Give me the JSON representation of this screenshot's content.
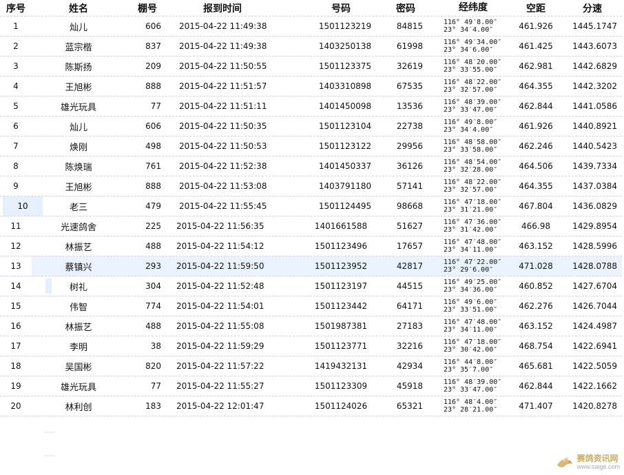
{
  "headers": {
    "idx": "序号",
    "name": "姓名",
    "loft": "棚号",
    "time": "报到时间",
    "ring": "号码",
    "pin": "密码",
    "coord": "经纬度",
    "distance": "空距",
    "speed": "分速"
  },
  "rows": [
    {
      "idx": "1",
      "name": "灿儿",
      "loft": "606",
      "time": "2015-04-22  11:49:38",
      "ring": "1501123219",
      "pin": "84815",
      "lon": "116° 49′8.00″",
      "lat": "23° 34′4.00″",
      "distance": "461.926",
      "speed": "1445.1747"
    },
    {
      "idx": "2",
      "name": "蓝宗楷",
      "loft": "837",
      "time": "2015-04-22  11:49:38",
      "ring": "1403250138",
      "pin": "61998",
      "lon": "116° 49′34.00″",
      "lat": "23° 34′6.00″",
      "distance": "461.425",
      "speed": "1443.6073"
    },
    {
      "idx": "3",
      "name": "陈斯扬",
      "loft": "209",
      "time": "2015-04-22  11:50:55",
      "ring": "1501123375",
      "pin": "32619",
      "lon": "116° 48′20.00″",
      "lat": "23° 33′55.00″",
      "distance": "462.981",
      "speed": "1442.6829"
    },
    {
      "idx": "4",
      "name": "王旭彬",
      "loft": "888",
      "time": "2015-04-22  11:51:57",
      "ring": "1403310898",
      "pin": "67535",
      "lon": "116° 48′22.00″",
      "lat": "23° 32′57.00″",
      "distance": "464.355",
      "speed": "1442.3202"
    },
    {
      "idx": "5",
      "name": "雄光玩具",
      "loft": "77",
      "time": "2015-04-22  11:51:11",
      "ring": "1401450098",
      "pin": "13536",
      "lon": "116° 48′39.00″",
      "lat": "23° 33′47.00″",
      "distance": "462.844",
      "speed": "1441.0586"
    },
    {
      "idx": "6",
      "name": "灿儿",
      "loft": "606",
      "time": "2015-04-22  11:50:35",
      "ring": "1501123104",
      "pin": "22738",
      "lon": "116° 49′8.00″",
      "lat": "23° 34′4.00″",
      "distance": "461.926",
      "speed": "1440.8921"
    },
    {
      "idx": "7",
      "name": "焕刚",
      "loft": "498",
      "time": "2015-04-22  11:50:53",
      "ring": "1501123122",
      "pin": "29956",
      "lon": "116° 48′58.00″",
      "lat": "23° 33′58.00″",
      "distance": "462.246",
      "speed": "1440.5423"
    },
    {
      "idx": "8",
      "name": "陈焕瑞",
      "loft": "761",
      "time": "2015-04-22  11:52:38",
      "ring": "1401450337",
      "pin": "36126",
      "lon": "116° 48′54.00″",
      "lat": "23° 32′28.00″",
      "distance": "464.506",
      "speed": "1439.7334"
    },
    {
      "idx": "9",
      "name": "王旭彬",
      "loft": "888",
      "time": "2015-04-22  11:53:08",
      "ring": "1403791180",
      "pin": "57141",
      "lon": "116° 48′22.00″",
      "lat": "23° 32′57.00″",
      "distance": "464.355",
      "speed": "1437.0384"
    },
    {
      "idx": "10",
      "name": "老三",
      "loft": "479",
      "time": "2015-04-22  11:55:45",
      "ring": "1501124495",
      "pin": "98668",
      "lon": "116° 47′18.00″",
      "lat": "23° 31′21.00″",
      "distance": "467.804",
      "speed": "1436.0829"
    },
    {
      "idx": "11",
      "name": "光速鸽舍",
      "loft": "225",
      "time": "2015-04-22  11:56:35",
      "ring": "1401661588",
      "pin": "51627",
      "lon": "116° 47′36.00″",
      "lat": "23° 31′42.00″",
      "distance": "466.98",
      "speed": "1429.8954"
    },
    {
      "idx": "12",
      "name": "林振艺",
      "loft": "488",
      "time": "2015-04-22  11:54:12",
      "ring": "1501123496",
      "pin": "17657",
      "lon": "116° 47′48.00″",
      "lat": "23° 34′11.00″",
      "distance": "463.152",
      "speed": "1428.5996"
    },
    {
      "idx": "13",
      "name": "蔡镇兴",
      "loft": "293",
      "time": "2015-04-22  11:59:50",
      "ring": "1501123952",
      "pin": "42817",
      "lon": "116° 47′22.00″",
      "lat": "23° 29′6.00″",
      "distance": "471.028",
      "speed": "1428.0788"
    },
    {
      "idx": "14",
      "name": "树礼",
      "loft": "304",
      "time": "2015-04-22  11:52:48",
      "ring": "1501123197",
      "pin": "44515",
      "lon": "116° 49′25.00″",
      "lat": "23° 34′36.00″",
      "distance": "460.852",
      "speed": "1427.6704"
    },
    {
      "idx": "15",
      "name": "伟智",
      "loft": "774",
      "time": "2015-04-22  11:54:01",
      "ring": "1501123442",
      "pin": "64171",
      "lon": "116° 49′6.00″",
      "lat": "23° 33′51.00″",
      "distance": "462.276",
      "speed": "1426.7044"
    },
    {
      "idx": "16",
      "name": "林振艺",
      "loft": "488",
      "time": "2015-04-22  11:55:08",
      "ring": "1501987381",
      "pin": "27183",
      "lon": "116° 47′48.00″",
      "lat": "23° 34′11.00″",
      "distance": "463.152",
      "speed": "1424.4987"
    },
    {
      "idx": "17",
      "name": "李明",
      "loft": "38",
      "time": "2015-04-22  11:59:29",
      "ring": "1501123771",
      "pin": "32216",
      "lon": "116° 47′18.00″",
      "lat": "23° 30′42.00″",
      "distance": "468.754",
      "speed": "1422.6941"
    },
    {
      "idx": "18",
      "name": "吴国彬",
      "loft": "820",
      "time": "2015-04-22  11:57:22",
      "ring": "1419432131",
      "pin": "42934",
      "lon": "116° 44′8.00″",
      "lat": "23° 35′7.00″",
      "distance": "465.681",
      "speed": "1422.5059"
    },
    {
      "idx": "19",
      "name": "雄光玩具",
      "loft": "77",
      "time": "2015-04-22  11:55:27",
      "ring": "1501123309",
      "pin": "45918",
      "lon": "116° 48′39.00″",
      "lat": "23° 33′47.00″",
      "distance": "462.844",
      "speed": "1422.1662"
    },
    {
      "idx": "20",
      "name": "林利创",
      "loft": "183",
      "time": "2015-04-22  12:01:47",
      "ring": "1501124026",
      "pin": "65321",
      "lon": "116° 48′4.00″",
      "lat": "23° 28′21.00″",
      "distance": "471.407",
      "speed": "1420.8278"
    }
  ],
  "watermark": {
    "title": "赛鸽资讯网",
    "url": "www.saige.com",
    "color": "#b7902f"
  },
  "colors": {
    "row_highlight": "#eaf2fd",
    "divider": "#cfd4dc"
  }
}
